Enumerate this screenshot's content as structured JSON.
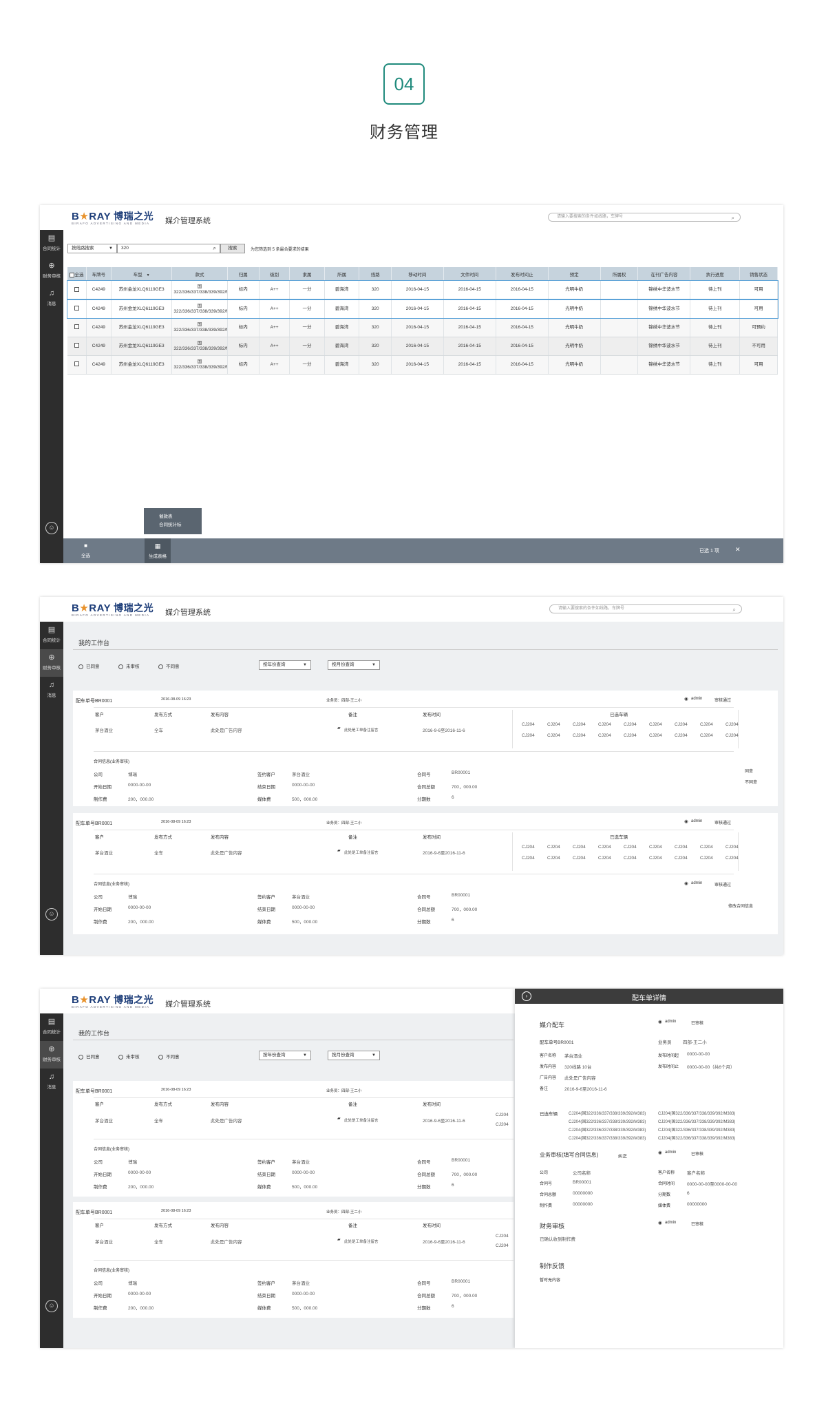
{
  "section": {
    "number": "04",
    "title": "财务管理"
  },
  "app": {
    "logo_en": "B",
    "logo_star": "★",
    "logo_ray": "RAY",
    "logo_cn": "博瑞之光",
    "logo_sub": "BIRAFO ADVERTISING AND MEDIA",
    "title": "媒介管理系统"
  },
  "screen1": {
    "search_placeholder": "请输入要搜索的条件如线路，车牌号",
    "nav": [
      {
        "icon": "document-icon",
        "label": "合同统计"
      },
      {
        "icon": "search-plus-icon",
        "label": "财务审核"
      },
      {
        "icon": "bell-icon",
        "label": "消息"
      }
    ],
    "filter": {
      "select": "按线路搜索",
      "input": "320",
      "search_btn": "搜索",
      "result": "为您筛选到 5 条最合要求的结果"
    },
    "columns": [
      "全选",
      "车牌号",
      "车型",
      "款式",
      "归属",
      "级别",
      "隶属",
      "所属",
      "线路",
      "移动时间",
      "文件时间",
      "发布时间止",
      "预定",
      "所属权",
      "在刊广告内容",
      "执行进度",
      "销售状态"
    ],
    "rows": [
      [
        "C4249",
        "苏州金龙XLQ6119GE3",
        "国322/336/337/338/339/392/M383",
        "标内",
        "A++",
        "一分",
        "碧海湾",
        "320",
        "2016-04-15",
        "2016-04-15",
        "2016-04-15",
        "光明牛奶",
        "",
        "锦绣中华波水节",
        "待上刊",
        "可用"
      ],
      [
        "C4249",
        "苏州金龙XLQ6119GE3",
        "国322/336/337/338/339/392/M383",
        "标内",
        "A++",
        "一分",
        "碧海湾",
        "320",
        "2016-04-15",
        "2016-04-15",
        "2016-04-15",
        "光明牛奶",
        "",
        "锦绣中华波水节",
        "待上刊",
        "可用"
      ],
      [
        "C4249",
        "苏州金龙XLQ6119GE3",
        "国322/336/337/338/339/392/M383",
        "标内",
        "A++",
        "一分",
        "碧海湾",
        "320",
        "2016-04-15",
        "2016-04-15",
        "2016-04-15",
        "光明牛奶",
        "",
        "锦绣中华波水节",
        "待上刊",
        "可预约"
      ],
      [
        "C4249",
        "苏州金龙XLQ6119GE3",
        "国322/336/337/338/339/392/M383",
        "标内",
        "A++",
        "一分",
        "碧海湾",
        "320",
        "2016-04-15",
        "2016-04-15",
        "2016-04-15",
        "光明牛奶",
        "",
        "锦绣中华波水节",
        "待上刊",
        "不可用"
      ],
      [
        "C4249",
        "苏州金龙XLQ6119GE3",
        "国322/336/337/338/339/392/M383",
        "标内",
        "A++",
        "一分",
        "碧海湾",
        "320",
        "2016-04-15",
        "2016-04-15",
        "2016-04-15",
        "光明牛奶",
        "",
        "锦绣中华波水节",
        "待上刊",
        "可用"
      ]
    ],
    "popup": [
      "催款表",
      "合同统计标"
    ],
    "bottom": {
      "select_all": "全选",
      "generate": "生成表格",
      "selected": "已选 1 项",
      "close": "✕"
    }
  },
  "screen2": {
    "search_placeholder": "请输入要搜索的条件如线路，车牌号",
    "workspace": "我的工作台",
    "radios": [
      "已同意",
      "未审核",
      "不同意"
    ],
    "selects": [
      "按年份查询",
      "按月份查询"
    ],
    "cards": [
      {
        "order": "配车单号BR0001",
        "date": "2016-08-09 16:23",
        "person": "业务员：四部-王二小",
        "admin": "admin",
        "status": "审核通过",
        "heads": {
          "client": "客户",
          "method": "发布方式",
          "content": "发布内容",
          "note": "备注",
          "time": "发布时间",
          "plates": "已选车辆"
        },
        "client": "茅台酒业",
        "method": "全车",
        "content": "此处是广告内容",
        "note": "此处是工单备注留言",
        "time": "2016-9-6至2016-11-6",
        "plates": [
          "CJ204",
          "CJ204",
          "CJ204",
          "CJ204",
          "CJ204",
          "CJ204",
          "CJ204",
          "CJ204",
          "CJ204",
          "CJ204",
          "CJ204",
          "CJ204",
          "CJ204",
          "CJ204",
          "CJ204",
          "CJ204",
          "CJ204",
          "CJ204"
        ],
        "contract_title": "合同信息(业务审核)",
        "contract": [
          [
            "公司",
            "博瑞",
            "签约客户",
            "茅台酒业",
            "合同号",
            "BR00001"
          ],
          [
            "开始日期",
            "0000-00-00",
            "结束日期",
            "0000-00-00",
            "合同总额",
            "700，000.00"
          ],
          [
            "制作费",
            "200，000.00",
            "媒体费",
            "500，000.00",
            "分期数",
            "6"
          ]
        ],
        "actions": [
          "同意",
          "不同意"
        ]
      },
      {
        "order": "配车单号BR0001",
        "date": "2016-08-09 16:23",
        "person": "业务员：四部-王二小",
        "admin": "admin",
        "status": "审核通过",
        "heads": {
          "client": "客户",
          "method": "发布方式",
          "content": "发布内容",
          "note": "备注",
          "time": "发布时间",
          "plates": "已选车辆"
        },
        "client": "茅台酒业",
        "method": "全车",
        "content": "此处是广告内容",
        "note": "此处是工单备注留言",
        "time": "2016-9-6至2016-11-6",
        "plates": [
          "CJ204",
          "CJ204",
          "CJ204",
          "CJ204",
          "CJ204",
          "CJ204",
          "CJ204",
          "CJ204",
          "CJ204",
          "CJ204",
          "CJ204",
          "CJ204",
          "CJ204",
          "CJ204",
          "CJ204",
          "CJ204",
          "CJ204",
          "CJ204"
        ],
        "contract_title": "合同信息(业务审核)",
        "contract": [
          [
            "公司",
            "博瑞",
            "签约客户",
            "茅台酒业",
            "合同号",
            "BR00001"
          ],
          [
            "开始日期",
            "0000-00-00",
            "结束日期",
            "0000-00-00",
            "合同总额",
            "700，000.00"
          ],
          [
            "制作费",
            "200，000.00",
            "媒体费",
            "500，000.00",
            "分期数",
            "6"
          ]
        ],
        "admin2": "admin",
        "status2": "审核通过",
        "actions": [
          "修改合同信息"
        ]
      }
    ]
  },
  "screen3": {
    "detail": {
      "header": "配车单详情",
      "sec1": "媒介配车",
      "admin": "admin",
      "status1": "已审核",
      "order": "配车单号BR0001",
      "salesman_label": "业务员",
      "salesman": "四部-王二小",
      "rows1": [
        [
          "客户名称",
          "茅台酒业",
          "发布时间起",
          "0000-00-00"
        ],
        [
          "发布内容",
          "320线路 10台",
          "发布时间止",
          "0000-00-00（共6个月）"
        ],
        [
          "广告内容",
          "此处是广告内容",
          "",
          ""
        ],
        [
          "备注",
          "2016-9-6至2016-11-6",
          "",
          ""
        ]
      ],
      "plates_label": "已选车辆",
      "plates": [
        "CJ204(国322/336/337/338/339/392/M383)",
        "CJ204(国322/336/337/338/339/392/M383)",
        "CJ204(国322/336/337/338/339/392/M383)",
        "CJ204(国322/336/337/338/339/392/M383)",
        "CJ204(国322/336/337/338/339/392/M383)",
        "CJ204(国322/336/337/338/339/392/M383)",
        "CJ204(国322/336/337/338/339/392/M383)",
        "CJ204(国322/336/337/338/339/392/M383)"
      ],
      "sec2": "业务审核(填写合同信息)",
      "correct": "纠正",
      "admin2": "admin",
      "status2": "已审核",
      "rows2": [
        [
          "公司",
          "公司名称",
          "客户名称",
          "客户名称"
        ],
        [
          "合同号",
          "BR00001",
          "合同时间",
          "0000-00-00至0000-00-00"
        ],
        [
          "合同总额",
          "00000000",
          "分期数",
          "6"
        ],
        [
          "制作费",
          "00000000",
          "媒体费",
          "00000000"
        ]
      ],
      "sec3": "财务审核",
      "admin3": "admin",
      "status3": "已审核",
      "confirm": "已确认收到制作费",
      "sec4": "制作反馈",
      "empty": "暂时无内容"
    },
    "cards": [
      {
        "order": "配车单号BR0001",
        "date": "2016-08-09 16:23",
        "person": "业务员：四部-王二小",
        "client": "茅台酒业",
        "method": "全车",
        "content": "此处是广告内容",
        "note": "此处是工单备注留言",
        "time": "2016-9-6至2016-11-6",
        "plates": [
          "CJ204",
          "CJ204"
        ]
      },
      {
        "order": "配车单号BR0001",
        "date": "2016-08-09 16:23",
        "person": "业务员：四部-王二小",
        "client": "茅台酒业",
        "method": "全车",
        "content": "此处是广告内容",
        "note": "此处是工单备注留言",
        "time": "2016-9-6至2016-11-6",
        "plates": [
          "CJ204",
          "CJ204"
        ]
      }
    ]
  }
}
